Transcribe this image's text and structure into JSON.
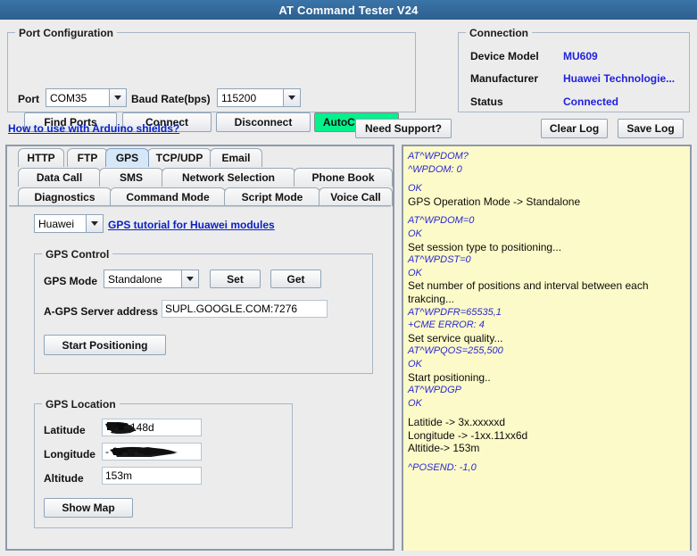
{
  "window": {
    "title": "AT Command Tester V24"
  },
  "port_configuration": {
    "legend": "Port Configuration",
    "port_label": "Port",
    "port_value": "COM35",
    "baud_label": "Baud Rate(bps)",
    "baud_value": "115200",
    "buttons": {
      "find_ports": "Find Ports",
      "connect": "Connect",
      "disconnect": "Disconnect",
      "autoconnect": "AutoConnect"
    },
    "autoconnect_color": "#06f08c"
  },
  "connection": {
    "legend": "Connection",
    "rows": [
      {
        "label": "Device Model",
        "value": "MU609"
      },
      {
        "label": "Manufacturer",
        "value": "Huawei Technologie..."
      },
      {
        "label": "Status",
        "value": "Connected"
      }
    ],
    "value_color": "#2222dd"
  },
  "toolbar": {
    "arduino_link": "How to use with Arduino shields?",
    "need_support": "Need Support?",
    "clear_log": "Clear Log",
    "save_log": "Save Log"
  },
  "tabs": {
    "row1": [
      {
        "label": "HTTP",
        "selected": false
      },
      {
        "label": "FTP",
        "selected": false
      },
      {
        "label": "GPS",
        "selected": true
      },
      {
        "label": "TCP/UDP",
        "selected": false
      },
      {
        "label": "Email",
        "selected": false
      }
    ],
    "row2": [
      {
        "label": "Data Call",
        "selected": false
      },
      {
        "label": "SMS",
        "selected": false
      },
      {
        "label": "Network Selection",
        "selected": false
      },
      {
        "label": "Phone Book",
        "selected": false
      }
    ],
    "row3": [
      {
        "label": "Diagnostics",
        "selected": false
      },
      {
        "label": "Command Mode",
        "selected": false
      },
      {
        "label": "Script Mode",
        "selected": false
      },
      {
        "label": "Voice Call",
        "selected": false
      }
    ]
  },
  "gps_tab": {
    "vendor_value": "Huawei",
    "tutorial_link": "GPS tutorial for Huawei modules",
    "gps_control": {
      "legend": "GPS Control",
      "mode_label": "GPS Mode",
      "mode_value": "Standalone",
      "set_button": "Set",
      "get_button": "Get",
      "agps_label": "A-GPS Server address",
      "agps_value": "SUPL.GOOGLE.COM:7276",
      "start_button": "Start Positioning"
    },
    "gps_location": {
      "legend": "GPS Location",
      "latitude_label": "Latitude",
      "latitude_value": "148d",
      "latitude_redacted": true,
      "longitude_label": "Longitude",
      "longitude_value": "-            6d",
      "longitude_redacted": true,
      "altitude_label": "Altitude",
      "altitude_value": "153m",
      "show_map_button": "Show Map"
    }
  },
  "log": {
    "background_color": "#fcfac8",
    "command_color": "#2a2ad4",
    "message_color": "#0c0c0c",
    "lines": [
      {
        "type": "cmd",
        "text": "AT^WPDOM?"
      },
      {
        "type": "cmd",
        "text": "^WPDOM: 0"
      },
      {
        "type": "blank",
        "text": ""
      },
      {
        "type": "cmd",
        "text": "OK"
      },
      {
        "type": "txt",
        "text": "GPS Operation Mode -> Standalone"
      },
      {
        "type": "blank",
        "text": ""
      },
      {
        "type": "cmd",
        "text": "AT^WPDOM=0"
      },
      {
        "type": "cmd",
        "text": "OK"
      },
      {
        "type": "txt",
        "text": "Set session type to positioning..."
      },
      {
        "type": "cmd",
        "text": "AT^WPDST=0"
      },
      {
        "type": "cmd",
        "text": "OK"
      },
      {
        "type": "txt",
        "text": "Set number of positions and interval between each trakcing..."
      },
      {
        "type": "cmd",
        "text": "AT^WPDFR=65535,1"
      },
      {
        "type": "cmd",
        "text": "+CME ERROR: 4"
      },
      {
        "type": "txt",
        "text": "Set service quality..."
      },
      {
        "type": "cmd",
        "text": "AT^WPQOS=255,500"
      },
      {
        "type": "cmd",
        "text": "OK"
      },
      {
        "type": "txt",
        "text": "Start positioning.."
      },
      {
        "type": "cmd",
        "text": "AT^WPDGP"
      },
      {
        "type": "cmd",
        "text": "OK"
      },
      {
        "type": "blank",
        "text": ""
      },
      {
        "type": "txt",
        "text": "Latitide -> 3x.xxxxxd"
      },
      {
        "type": "txt",
        "text": "Longitude -> -1xx.11xx6d"
      },
      {
        "type": "txt",
        "text": "Altitide-> 153m"
      },
      {
        "type": "blank",
        "text": ""
      },
      {
        "type": "cmd",
        "text": "^POSEND: -1,0"
      }
    ]
  }
}
